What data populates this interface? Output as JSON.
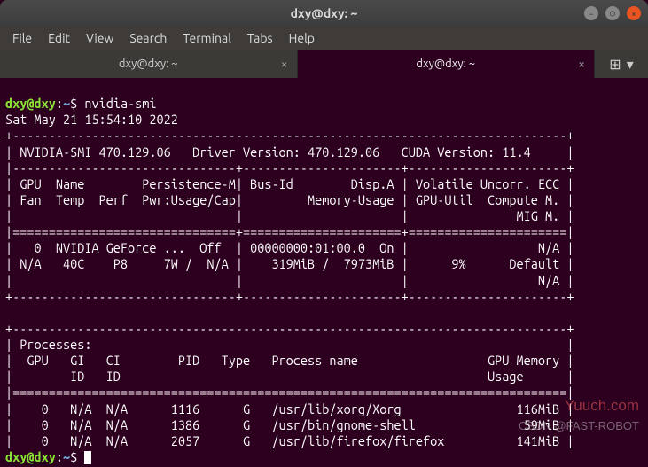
{
  "window": {
    "title": "dxy@dxy: ~"
  },
  "menu": {
    "file": "File",
    "edit": "Edit",
    "view": "View",
    "search": "Search",
    "terminal": "Terminal",
    "tabs": "Tabs",
    "help": "Help"
  },
  "tabs": {
    "tab1": "dxy@dxy: ~",
    "tab2": "dxy@dxy: ~"
  },
  "prompt": {
    "userhost": "dxy@dxy",
    "colon": ":",
    "path": "~",
    "dollar": "$"
  },
  "terminal": {
    "command": "nvidia-smi",
    "timestamp": "Sat May 21 15:54:10 2022",
    "hr_top": "+-----------------------------------------------------------------------------+",
    "smi_line": "| NVIDIA-SMI 470.129.06   Driver Version: 470.129.06   CUDA Version: 11.4     |",
    "hr_hdr": "|-------------------------------+----------------------+----------------------+",
    "hdr1": "| GPU  Name        Persistence-M| Bus-Id        Disp.A | Volatile Uncorr. ECC |",
    "hdr2": "| Fan  Temp  Perf  Pwr:Usage/Cap|         Memory-Usage | GPU-Util  Compute M. |",
    "hdr3": "|                               |                      |               MIG M. |",
    "hr_dbl": "|===============================+======================+======================|",
    "gpu1": "|   0  NVIDIA GeForce ...  Off  | 00000000:01:00.0  On |                  N/A |",
    "gpu2": "| N/A   40C    P8     7W /  N/A |    319MiB /  7973MiB |      9%      Default |",
    "gpu3": "|                               |                      |                  N/A |",
    "hr_bot": "+-------------------------------+----------------------+----------------------+",
    "blank": "",
    "proc_top": "+-----------------------------------------------------------------------------+",
    "proc_hdr": "| Processes:                                                                  |",
    "proc_h1": "|  GPU   GI   CI        PID   Type   Process name                  GPU Memory |",
    "proc_h2": "|        ID   ID                                                   Usage      |",
    "proc_sep": "|=============================================================================|",
    "proc_r1": "|    0   N/A  N/A      1116      G   /usr/lib/xorg/Xorg                116MiB |",
    "proc_r2": "|    0   N/A  N/A      1386      G   /usr/bin/gnome-shell               59MiB |",
    "proc_r3": "|    0   N/A  N/A      2057      G   /usr/lib/firefox/firefox          141MiB |"
  },
  "watermark": {
    "w1": "Yuuch.com",
    "w2": "CSDN @FAST-ROBOT"
  }
}
